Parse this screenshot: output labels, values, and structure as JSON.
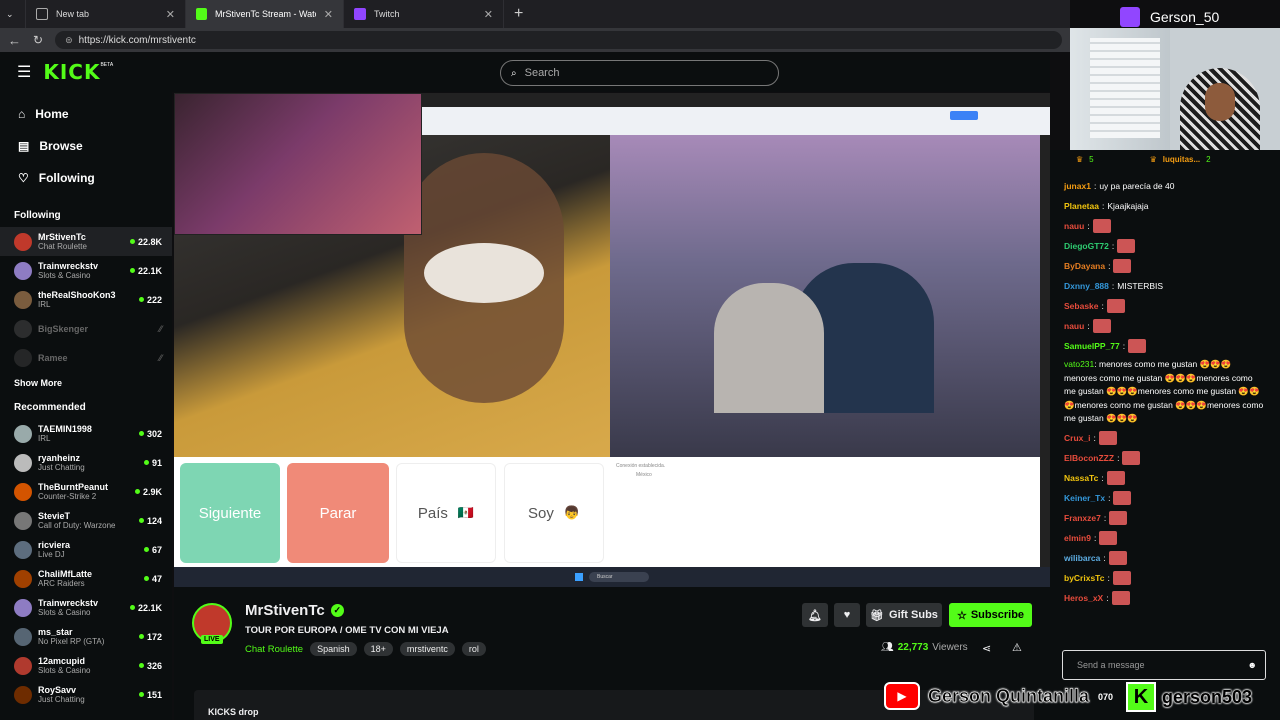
{
  "browser": {
    "tabs": [
      {
        "label": "New tab",
        "icon": "newtab-icon"
      },
      {
        "label": "MrStivenTc Stream - Watch Li...",
        "icon": "kick-icon"
      },
      {
        "label": "Twitch",
        "icon": "twitch-icon"
      }
    ],
    "url": "https://kick.com/mrstiventc"
  },
  "topbar": {
    "logo": "KICK",
    "logo_badge": "BETA",
    "search_placeholder": "Search"
  },
  "nav": [
    {
      "label": "Home",
      "icon": "home-icon"
    },
    {
      "label": "Browse",
      "icon": "browse-icon"
    },
    {
      "label": "Following",
      "icon": "heart-icon"
    }
  ],
  "sidebar": {
    "following_title": "Following",
    "following": [
      {
        "name": "MrStivenTc",
        "category": "Chat Roulette",
        "viewers": "22.8K",
        "color": "#c0392b",
        "live": true
      },
      {
        "name": "Trainwreckstv",
        "category": "Slots & Casino",
        "viewers": "22.1K",
        "color": "#8e7cc3",
        "live": true
      },
      {
        "name": "theRealShooKon3",
        "category": "IRL",
        "viewers": "222",
        "color": "#7a5c3e",
        "live": true
      },
      {
        "name": "BigSkenger",
        "category": "",
        "viewers": "",
        "color": "#555",
        "live": false
      },
      {
        "name": "Ramee",
        "category": "",
        "viewers": "",
        "color": "#444",
        "live": false
      }
    ],
    "show_more": "Show More",
    "recommended_title": "Recommended",
    "recommended": [
      {
        "name": "TAEMIN1998",
        "category": "IRL",
        "viewers": "302",
        "color": "#9aa"
      },
      {
        "name": "ryanheinz",
        "category": "Just Chatting",
        "viewers": "91",
        "color": "#bbb"
      },
      {
        "name": "TheBurntPeanut",
        "category": "Counter-Strike 2",
        "viewers": "2.9K",
        "color": "#d35400"
      },
      {
        "name": "StevieT",
        "category": "Call of Duty: Warzone",
        "viewers": "124",
        "color": "#777"
      },
      {
        "name": "ricviera",
        "category": "Live DJ",
        "viewers": "67",
        "color": "#5d6d7e"
      },
      {
        "name": "ChaliMfLatte",
        "category": "ARC Raiders",
        "viewers": "47",
        "color": "#a04000"
      },
      {
        "name": "Trainwreckstv",
        "category": "Slots & Casino",
        "viewers": "22.1K",
        "color": "#8e7cc3"
      },
      {
        "name": "ms_star",
        "category": "No Pixel RP (GTA)",
        "viewers": "172",
        "color": "#566573"
      },
      {
        "name": "12amcupid",
        "category": "Slots & Casino",
        "viewers": "326",
        "color": "#b03a2e"
      },
      {
        "name": "RoySavv",
        "category": "Just Chatting",
        "viewers": "151",
        "color": "#6e2c00"
      }
    ]
  },
  "player": {
    "buttons": [
      {
        "label": "Siguiente"
      },
      {
        "label": "Parar"
      },
      {
        "label": "País"
      },
      {
        "label": "Soy"
      }
    ],
    "status_text": "Conexión establecida.",
    "status_sub": "México",
    "taskbar_search": "Buscar"
  },
  "stream": {
    "channel": "MrStivenTc",
    "live_badge": "LIVE",
    "title": "TOUR POR EUROPA / OME TV CON MI VIEJA",
    "category": "Chat Roulette",
    "tags": [
      "Spanish",
      "18+",
      "mrstiventc",
      "rol"
    ],
    "viewers": "22,773",
    "viewers_label": "Viewers",
    "gift_label": "Gift Subs",
    "subscribe_label": "Subscribe",
    "kicks_label": "KICKS drop"
  },
  "twitch_overlay": {
    "username": "Gerson_50"
  },
  "chat": {
    "top_users": [
      {
        "name": "",
        "count": "5"
      },
      {
        "name": "luquitas...",
        "count": "2"
      }
    ],
    "messages": [
      {
        "user": "junax1",
        "text": "uy pa parecía de 40",
        "color": "#f39c12"
      },
      {
        "user": "Planetaa",
        "text": "Kjaajkajaja",
        "color": "#f1c40f"
      },
      {
        "user": "nauu",
        "text": "",
        "color": "#e74c3c",
        "emote": true
      },
      {
        "user": "DiegoGT72",
        "text": "",
        "color": "#2ecc71",
        "emote": true
      },
      {
        "user": "ByDayana",
        "text": "",
        "color": "#e67e22",
        "emote": true
      },
      {
        "user": "Dxnny_888",
        "text": "MISTERBIS",
        "color": "#3498db"
      },
      {
        "user": "Sebaske",
        "text": "",
        "color": "#e74c3c",
        "emote": true
      },
      {
        "user": "nauu",
        "text": "",
        "color": "#e74c3c",
        "emote": true
      },
      {
        "user": "SamuelPP_77",
        "text": "",
        "color": "#53fc18",
        "emote": true
      }
    ],
    "spam_user": "vato231",
    "spam_text": "menores como me gustan 😍😍😍 menores como me gustan 😍😍😍menores como me gustan 😍😍😍menores como me gustan 😍😍😍menores como me gustan 😍😍😍menores como me gustan 😍😍😍",
    "messages2": [
      {
        "user": "Crux_i",
        "color": "#e74c3c"
      },
      {
        "user": "ElBoconZZZ",
        "color": "#e74c3c"
      },
      {
        "user": "NassaTc",
        "color": "#f1c40f"
      },
      {
        "user": "Keiner_Tx",
        "color": "#3498db"
      },
      {
        "user": "Franxze7",
        "color": "#e74c3c"
      },
      {
        "user": "elmin9",
        "color": "#e74c3c"
      },
      {
        "user": "wilibarca",
        "color": "#5dade2"
      },
      {
        "user": "byCrixsTc",
        "color": "#f1c40f"
      },
      {
        "user": "Heros_xX",
        "color": "#e74c3c"
      }
    ],
    "input_placeholder": "Send a message",
    "points": "070"
  },
  "overlay_bottom": {
    "youtube_name": "Gerson Quintanilla",
    "kick_name": "gerson503"
  }
}
